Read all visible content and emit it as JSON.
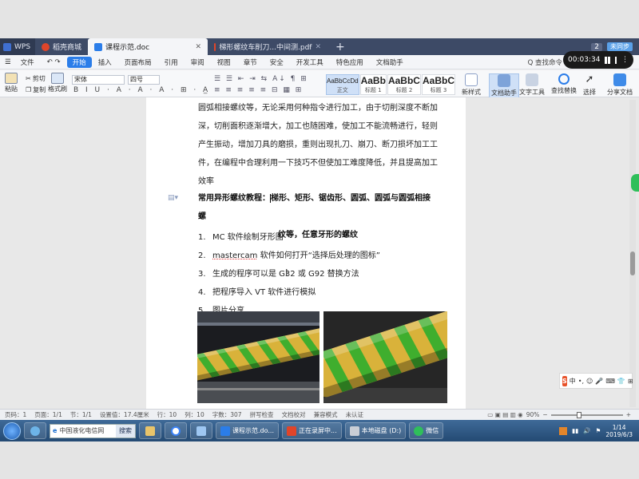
{
  "tabs": [
    {
      "label": "WPS",
      "color": "#3f6fd1"
    },
    {
      "label": "稻壳商城",
      "color": "#e0452a"
    },
    {
      "label": "课程示范.doc",
      "color": "#2b7de9",
      "active": true
    },
    {
      "label": "梯形螺纹车削刀...中间测.pdf",
      "color": "#e0452a"
    }
  ],
  "tabbar": {
    "count_badge": "2",
    "cloud_label": "未同步"
  },
  "recorder": {
    "time": "00:03:34"
  },
  "menu": {
    "file": "文件",
    "items": [
      "开始",
      "插入",
      "页面布局",
      "引用",
      "审阅",
      "视图",
      "章节",
      "安全",
      "开发工具",
      "特色应用",
      "文档助手"
    ],
    "search": "Q 查找命令"
  },
  "ribbon": {
    "paste": "粘贴",
    "cut": "剪切",
    "copy": "复制",
    "format_painter": "格式刷",
    "font": "宋体",
    "size": "四号",
    "styles": [
      {
        "preview": "AaBbCcDd",
        "name": "正文"
      },
      {
        "preview": "AaBb",
        "name": "标题 1"
      },
      {
        "preview": "AaBbC",
        "name": "标题 2"
      },
      {
        "preview": "AaBbC",
        "name": "标题 3"
      }
    ],
    "new_style": "新样式",
    "doc_helper": "文档助手",
    "text_tools": "文字工具",
    "find_replace": "查找替换",
    "select": "选择",
    "share": "分享文档"
  },
  "document": {
    "paragraph_lines": [
      "圆弧相接螺纹等，无论采用何种指令进行加工，由于切削深度不断加",
      "深，切削面积逐渐增大，加工也随困难，使加工不能流畅进行，轻则",
      "产生振动，增加刀具的磨损，重则出现扎刀、崩刀、断刀损坏加工工",
      "件，在编程中合理利用一下技巧不但使加工难度降低，并且提高加工",
      "效率"
    ],
    "heading_part1": "常用异形螺纹教程：",
    "heading_part2": "梯形、矩形、锯齿形、圆弧、圆弧与圆弧相接螺",
    "heading_line2": "纹等，任意牙形的螺纹",
    "list": [
      {
        "num": "1.",
        "text": "MC 软件绘制牙形图"
      },
      {
        "num": "2.",
        "u": "mastercam",
        "text": " 软件如何打开“选择后处理的图标”"
      },
      {
        "num": "3.",
        "text": "生成的程序可以是 G32 或 G92 替换方法"
      },
      {
        "num": "4.",
        "text": "把程序导入 VT 软件进行模拟"
      },
      {
        "num": "5.",
        "text": "图片分享"
      }
    ]
  },
  "ime": {
    "logo": "S",
    "mode": "中"
  },
  "status": {
    "page_num": "页码：1",
    "page": "页面：1/1",
    "section": "节：1/1",
    "setting": "设置值：17.4厘米",
    "row": "行：10",
    "col": "列：10",
    "words": "字数：307",
    "spell": "拼写检查",
    "compare": "文档校对",
    "compat": "兼容模式",
    "cert": "未认证",
    "zoom": "90%"
  },
  "taskbar": {
    "address": "中国液化电信网",
    "go": "搜索",
    "items": [
      "课程示范.do...",
      "正在录屏中...",
      "本地磁盘 (D:)",
      "微信"
    ],
    "time": "1/14",
    "date": "2019/6/3"
  },
  "colors": {
    "accent": "#2b7de9",
    "tabbar": "#3d4a66",
    "thread_yellow": "#d9b23a",
    "thread_green": "#3fae2e"
  }
}
